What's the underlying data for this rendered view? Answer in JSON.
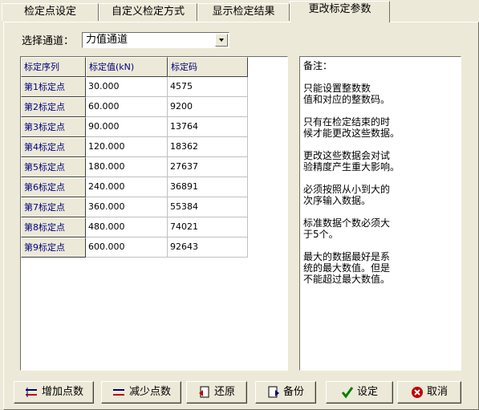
{
  "tabs": [
    {
      "label": "检定点设定"
    },
    {
      "label": "自定义检定方式"
    },
    {
      "label": "显示检定结果"
    },
    {
      "label": "更改标定参数"
    }
  ],
  "channel": {
    "label": "选择通道：",
    "selected": "力值通道"
  },
  "grid": {
    "headers": [
      "标定序列",
      "标定值(kN)",
      "标定码"
    ],
    "rows": [
      {
        "name": "第1标定点",
        "value": "30.000",
        "code": "4575"
      },
      {
        "name": "第2标定点",
        "value": "60.000",
        "code": "9200"
      },
      {
        "name": "第3标定点",
        "value": "90.000",
        "code": "13764"
      },
      {
        "name": "第4标定点",
        "value": "120.000",
        "code": "18362"
      },
      {
        "name": "第5标定点",
        "value": "180.000",
        "code": "27637"
      },
      {
        "name": "第6标定点",
        "value": "240.000",
        "code": "36891"
      },
      {
        "name": "第7标定点",
        "value": "360.000",
        "code": "55384"
      },
      {
        "name": "第8标定点",
        "value": "480.000",
        "code": "74021"
      },
      {
        "name": "第9标定点",
        "value": "600.000",
        "code": "92643"
      }
    ]
  },
  "notes": {
    "title": "备注：",
    "items": [
      "只能设置整数数\n值和对应的整数码。",
      "只有在检定结束的时\n候才能更改这些数据。",
      "更改这些数据会对试\n验精度产生重大影响。",
      "必须按照从小到大的\n次序输入数据。",
      "标准数据个数必须大\n于5个。",
      "最大的数据最好是系\n统的最大数值。但是\n不能超过最大数值。"
    ]
  },
  "buttons": {
    "add": "增加点数",
    "remove": "减少点数",
    "restore": "还原",
    "backup": "备份",
    "set": "设定",
    "cancel": "取消"
  },
  "colors": {
    "face": "#ece9d8",
    "header_text": "#000080",
    "check_green": "#008000",
    "cancel_red": "#c00000"
  }
}
